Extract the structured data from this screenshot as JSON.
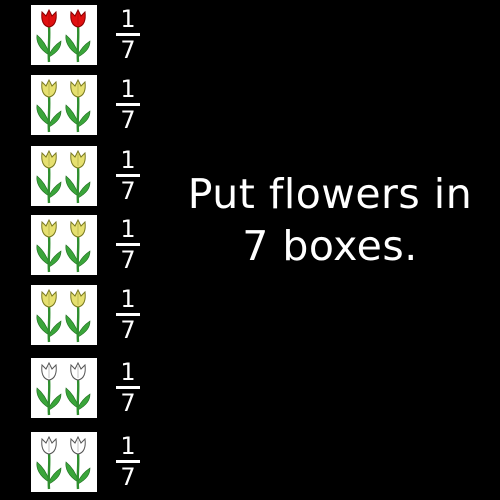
{
  "rows": [
    {
      "fraction": {
        "numerator": "1",
        "denominator": "7"
      },
      "flower_color": "#e01010",
      "flower_stroke": "#8a0000"
    },
    {
      "fraction": {
        "numerator": "1",
        "denominator": "7"
      },
      "flower_color": "#e6e070",
      "flower_stroke": "#7a7a20"
    },
    {
      "fraction": {
        "numerator": "1",
        "denominator": "7"
      },
      "flower_color": "#e6e070",
      "flower_stroke": "#7a7a20"
    },
    {
      "fraction": {
        "numerator": "1",
        "denominator": "7"
      },
      "flower_color": "#e6e070",
      "flower_stroke": "#7a7a20"
    },
    {
      "fraction": {
        "numerator": "1",
        "denominator": "7"
      },
      "flower_color": "#e6e070",
      "flower_stroke": "#7a7a20"
    },
    {
      "fraction": {
        "numerator": "1",
        "denominator": "7"
      },
      "flower_color": "#ffffff",
      "flower_stroke": "#555555"
    },
    {
      "fraction": {
        "numerator": "1",
        "denominator": "7"
      },
      "flower_color": "#ffffff",
      "flower_stroke": "#555555"
    }
  ],
  "message": {
    "line1": "Put flowers in",
    "line2": "7 boxes."
  },
  "colors": {
    "background": "#000000",
    "text": "#ffffff",
    "box": "#ffffff",
    "stem": "#2f8f2f",
    "leaf": "#3aa53a"
  },
  "icons": {
    "flower": "tulip-icon"
  }
}
